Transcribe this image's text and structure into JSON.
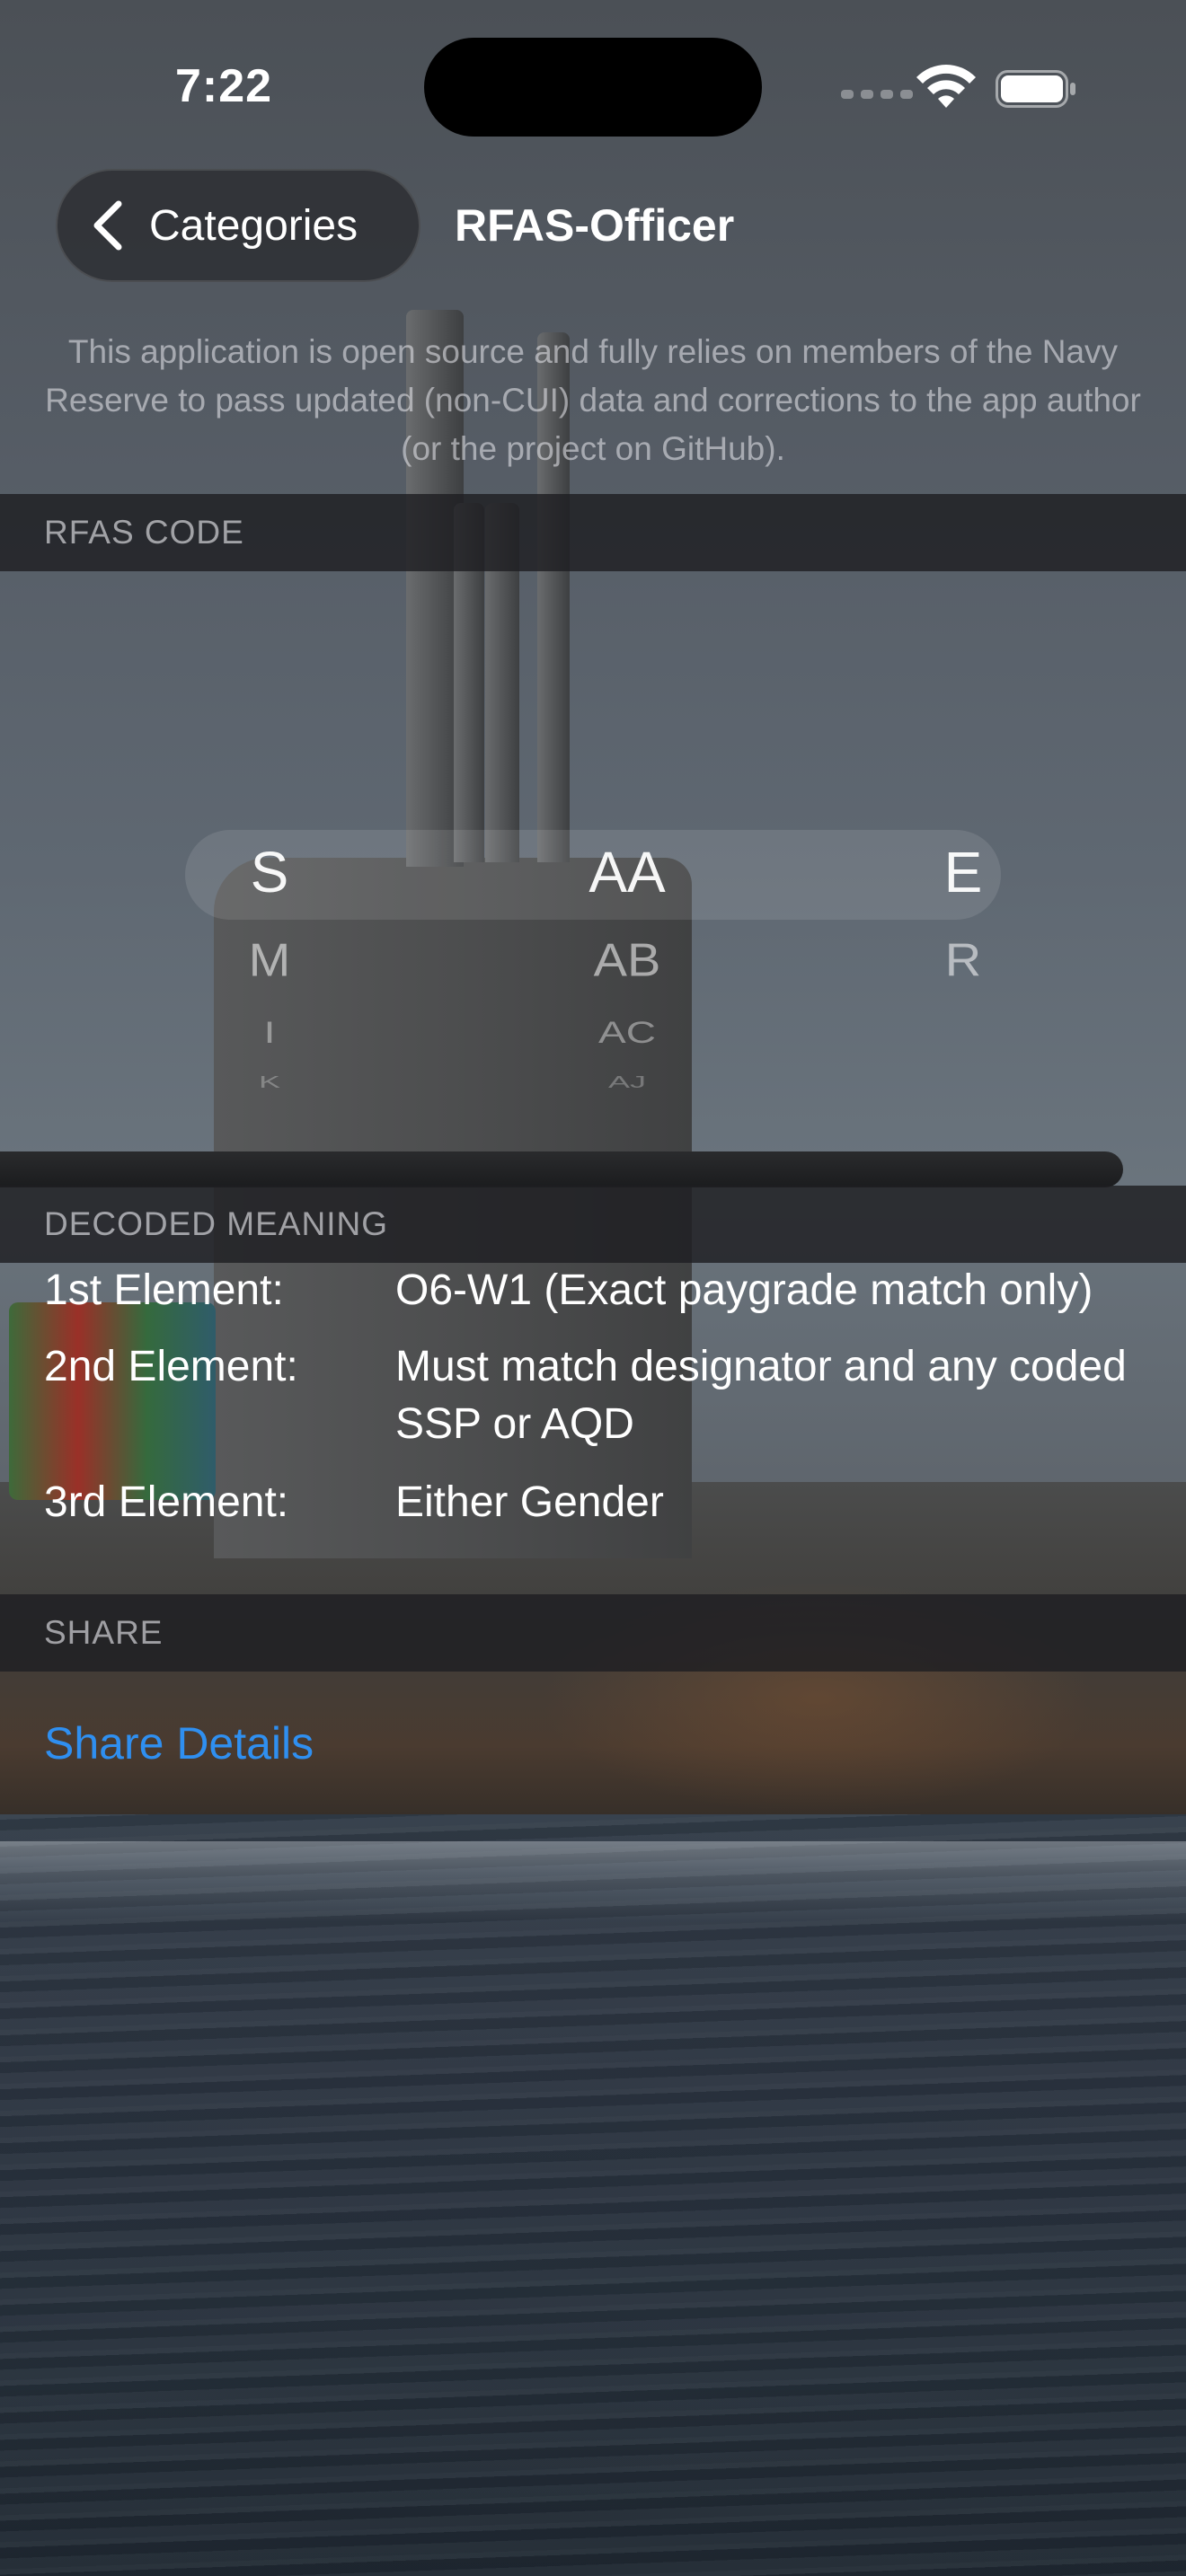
{
  "status_bar": {
    "time": "7:22"
  },
  "nav": {
    "back_label": "Categories",
    "title": "RFAS-Officer"
  },
  "disclaimer": "This application is open source and fully relies on members of the Navy Reserve to pass updated (non-CUI) data and corrections to the app author (or the project on GitHub).",
  "sections": {
    "rfas_code": "RFAS CODE",
    "decoded_meaning": "DECODED MEANING",
    "share": "SHARE"
  },
  "picker": {
    "columns": [
      {
        "selected": "S",
        "items": [
          "S",
          "M",
          "I",
          "K"
        ]
      },
      {
        "selected": "AA",
        "items": [
          "AA",
          "AB",
          "AC",
          "AJ"
        ]
      },
      {
        "selected": "E",
        "items": [
          "E",
          "R"
        ]
      }
    ]
  },
  "decoded": [
    {
      "label": "1st Element:",
      "value": "O6-W1 (Exact paygrade match only)"
    },
    {
      "label": "2nd Element:",
      "value": "Must match designator and any coded SSP or AQD"
    },
    {
      "label": "3rd Element:",
      "value": "Either Gender"
    }
  ],
  "share": {
    "link_label": "Share Details"
  },
  "colors": {
    "accent": "#2f8ff0",
    "section_bg": "#1e1f22"
  }
}
